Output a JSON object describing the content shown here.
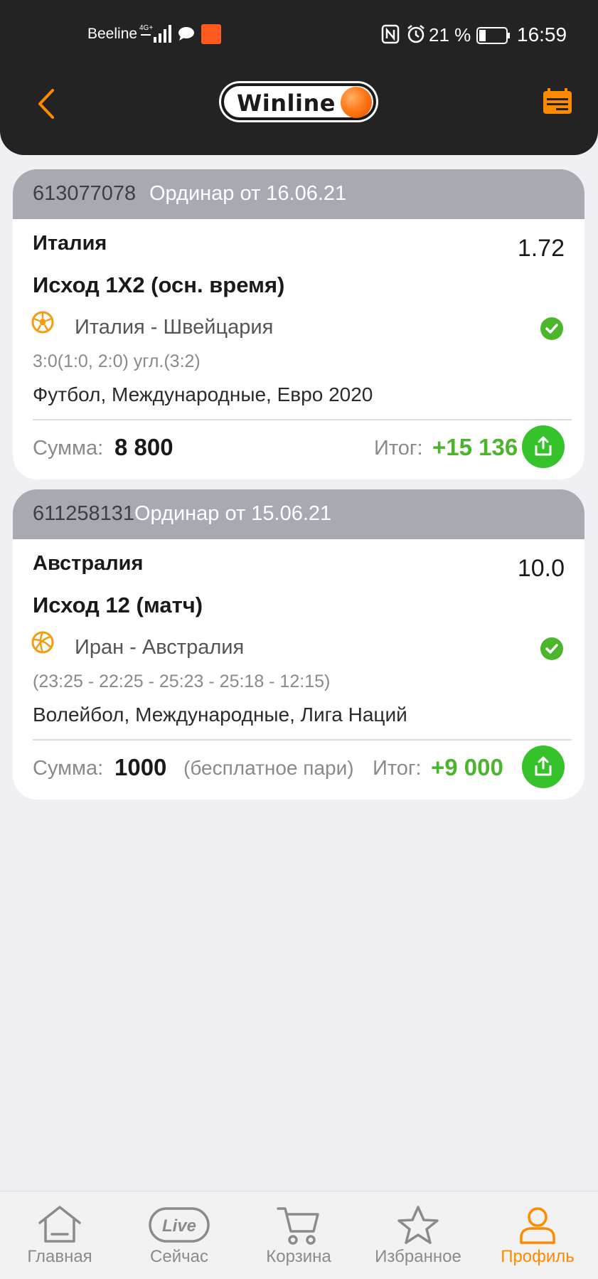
{
  "status_bar": {
    "carrier": "Beeline",
    "network": "4G+",
    "battery_percent": "21 %",
    "time": "16:59"
  },
  "header": {
    "logo_text": "Winline",
    "accent_color": "#ff8a00"
  },
  "bets": [
    {
      "id": "613077078",
      "type": "Ординар от 16.06.21",
      "pick": "Италия",
      "coef": "1.72",
      "market": "Исход 1X2 (осн. время)",
      "sport_icon": "football-icon",
      "event": "Италия - Швейцария",
      "score": "3:0(1:0, 2:0) угл.(3:2)",
      "league": "Футбол, Международные, Евро 2020",
      "sum_label": "Сумма:",
      "sum_value": "8 800",
      "note": "",
      "result_label": "Итог:",
      "result_value": "+15 136",
      "status": "won"
    },
    {
      "id": "611258131",
      "type": "Ординар от 15.06.21",
      "pick": "Австралия",
      "coef": "10.0",
      "market": "Исход 12 (матч)",
      "sport_icon": "volleyball-icon",
      "event": "Иран - Австралия",
      "score": "(23:25 - 22:25 - 25:23 - 25:18 - 12:15)",
      "league": "Волейбол, Международные, Лига Наций",
      "sum_label": "Сумма:",
      "sum_value": "1000",
      "note": "(бесплатное пари)",
      "result_label": "Итог:",
      "result_value": "+9 000",
      "status": "won"
    }
  ],
  "tabbar": {
    "items": [
      {
        "label": "Главная",
        "icon": "home-icon"
      },
      {
        "label": "Сейчас",
        "icon": "live-icon",
        "badge": "Live"
      },
      {
        "label": "Корзина",
        "icon": "cart-icon"
      },
      {
        "label": "Избранное",
        "icon": "star-icon"
      },
      {
        "label": "Профиль",
        "icon": "profile-icon",
        "active": true
      }
    ]
  }
}
